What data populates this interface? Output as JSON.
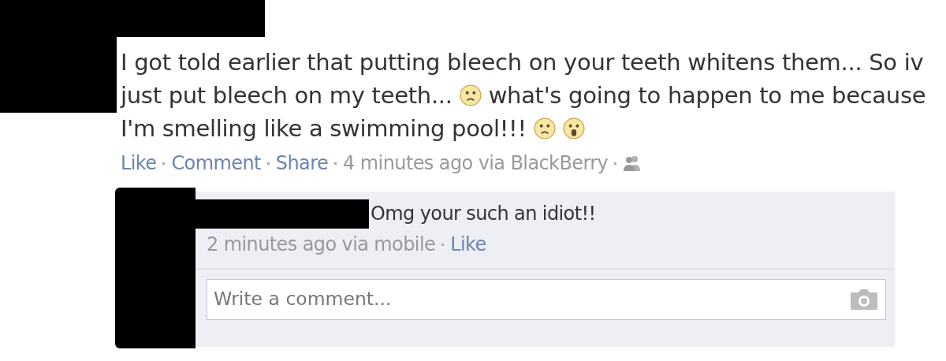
{
  "post": {
    "lines": [
      [
        {
          "kind": "text",
          "text": "I got told earlier that putting bleech on your teeth whitens them... So iv"
        }
      ],
      [
        {
          "kind": "text",
          "text": "just put bleech on my teeth..."
        },
        {
          "kind": "sad-face"
        },
        {
          "kind": "text",
          "text": "what's going to happen to me because"
        }
      ],
      [
        {
          "kind": "text",
          "text": "I'm smelling like a swimming pool!!!"
        },
        {
          "kind": "sad-face"
        },
        {
          "kind": "shocked-face"
        }
      ]
    ],
    "actions": [
      "Like",
      "Comment",
      "Share"
    ],
    "timestamp": "4 minutes ago via BlackBerry"
  },
  "comments": [
    {
      "text": "Omg your such an idiot!!",
      "timestamp": "2 minutes ago via mobile",
      "like": "Like"
    }
  ],
  "comment_box": {
    "placeholder": "Write a comment..."
  }
}
